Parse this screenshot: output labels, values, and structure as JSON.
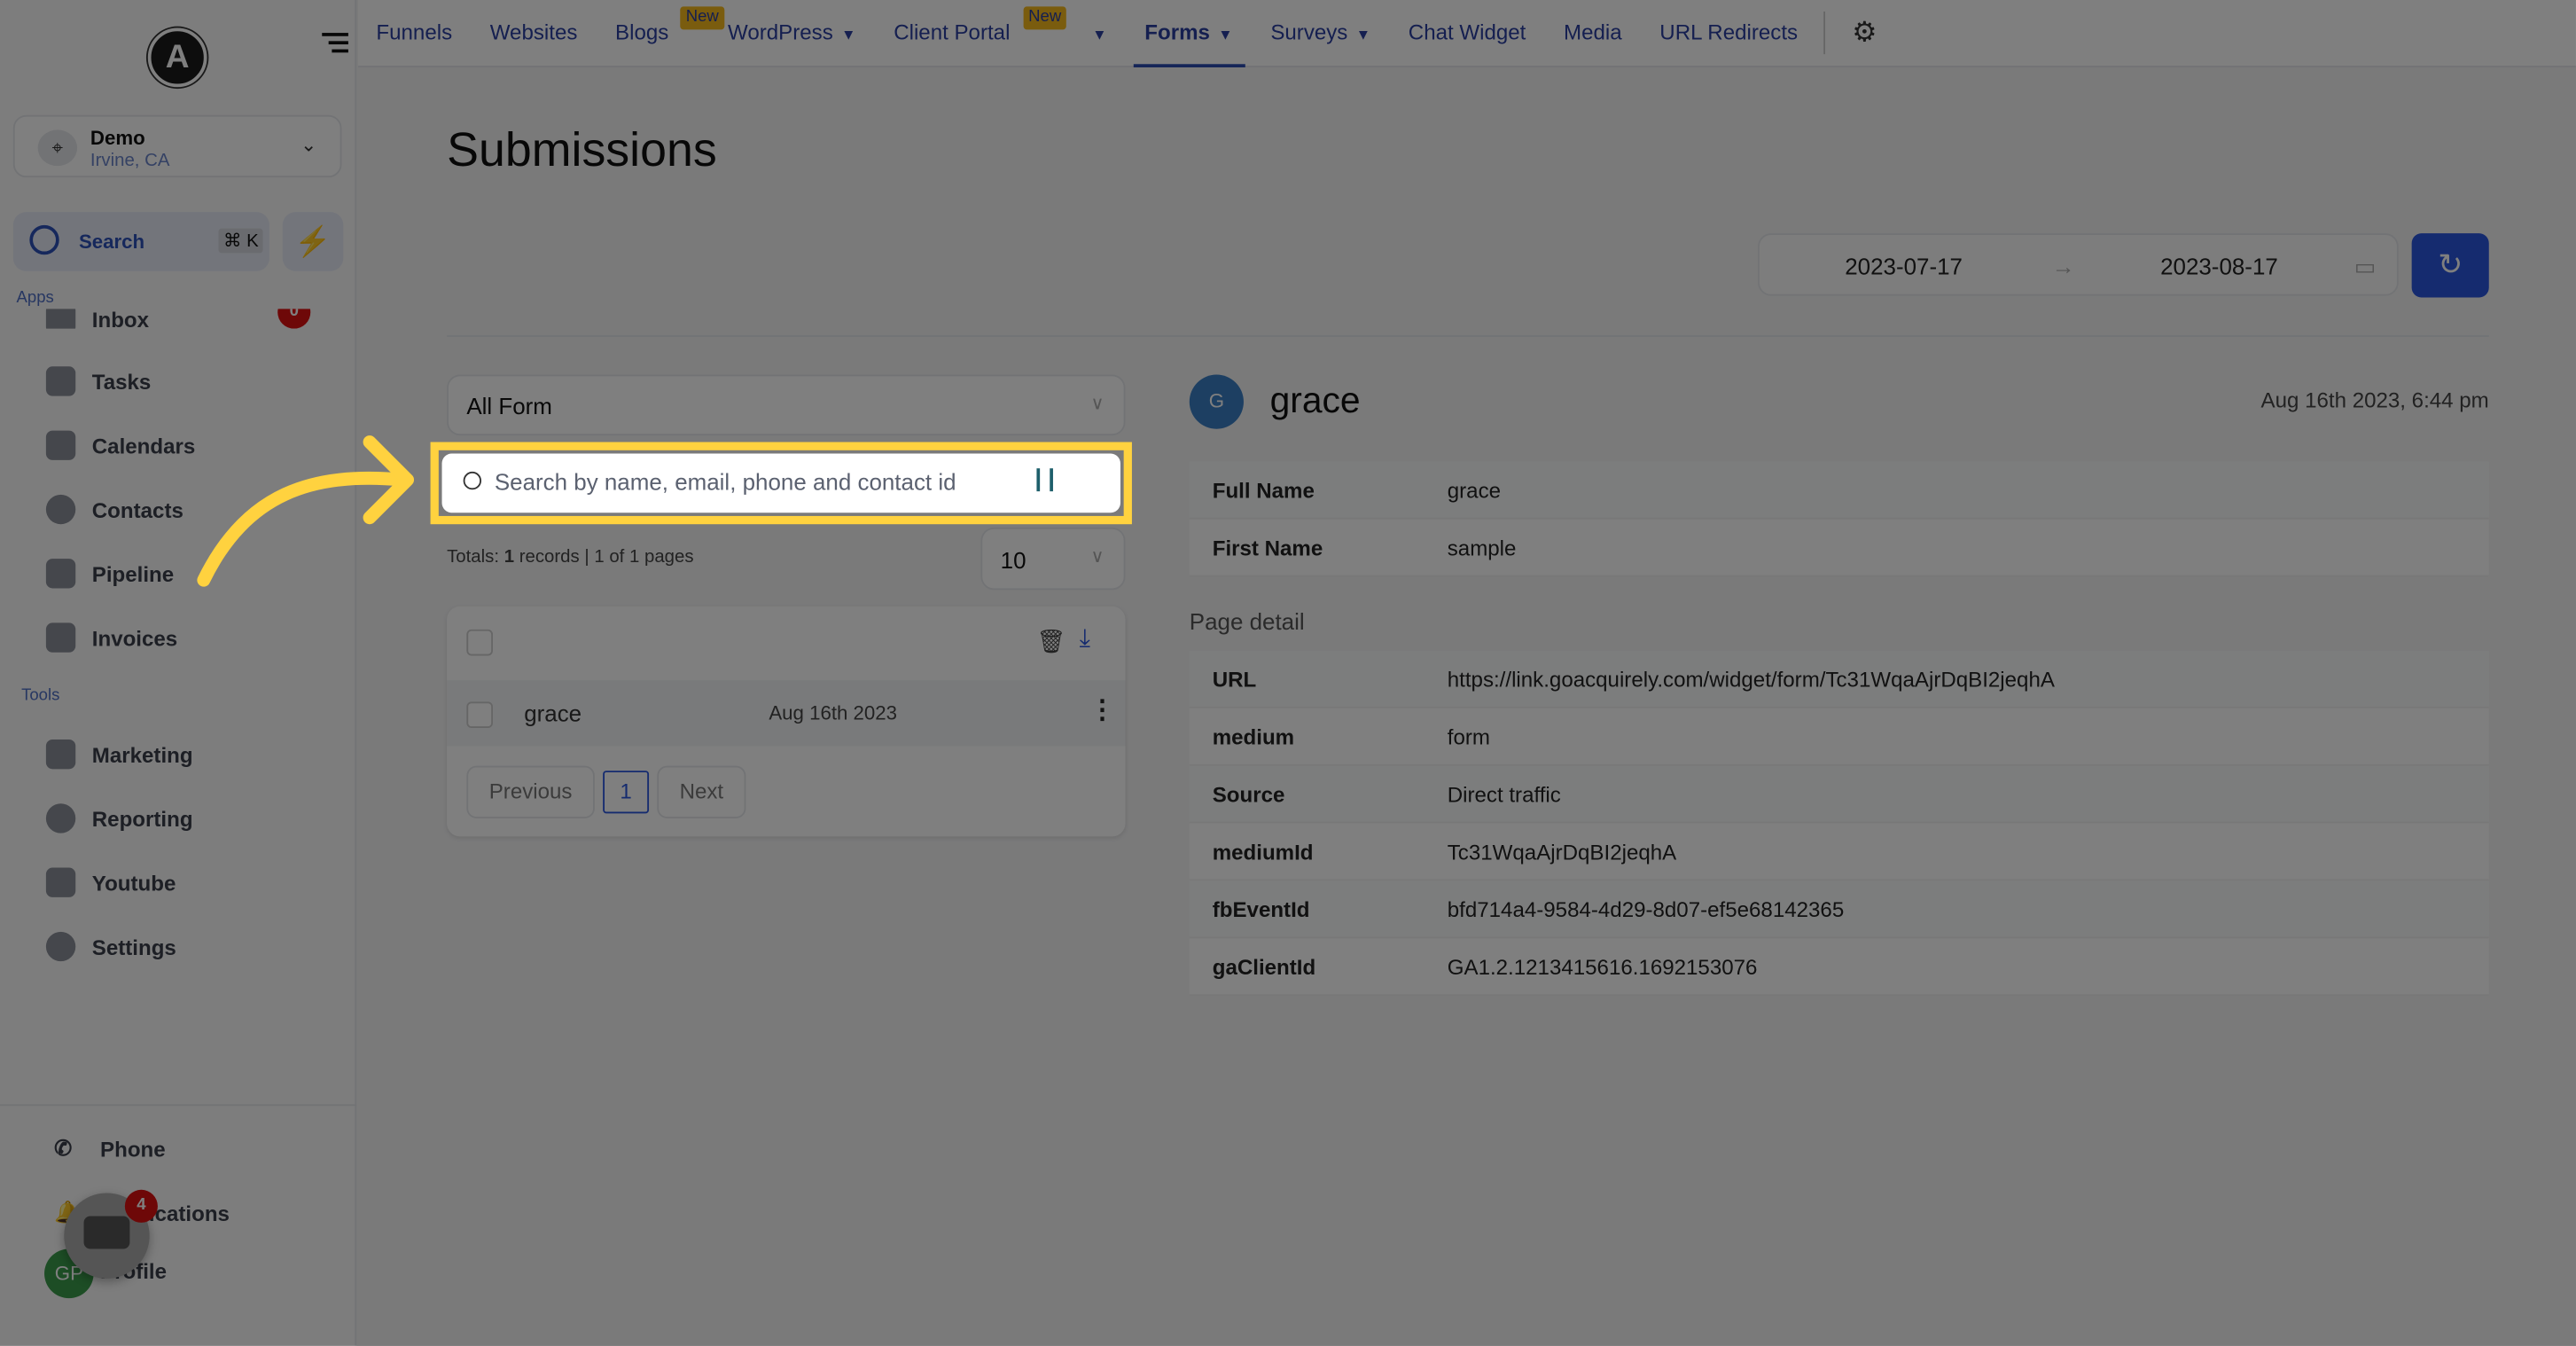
{
  "sidebar": {
    "account": {
      "name": "Demo",
      "location": "Irvine, CA"
    },
    "search_label": "Search",
    "shortcut": "⌘ K",
    "apps_label": "Apps",
    "tools_label": "Tools",
    "apps": [
      {
        "label": "Inbox",
        "badge": "0"
      },
      {
        "label": "Tasks"
      },
      {
        "label": "Calendars"
      },
      {
        "label": "Contacts"
      },
      {
        "label": "Pipeline"
      },
      {
        "label": "Invoices"
      }
    ],
    "tools": [
      {
        "label": "Marketing"
      },
      {
        "label": "Reporting"
      },
      {
        "label": "Youtube"
      },
      {
        "label": "Settings"
      }
    ],
    "bottom": [
      {
        "label": "Phone"
      },
      {
        "label": "Notifications"
      },
      {
        "label": "Profile"
      }
    ],
    "chat_badge": "4",
    "profile_initials": "GP"
  },
  "topnav": {
    "items": [
      {
        "label": "Funnels"
      },
      {
        "label": "Websites"
      },
      {
        "label": "Blogs",
        "badge": "New"
      },
      {
        "label": "WordPress"
      },
      {
        "label": "Client Portal",
        "badge": "New"
      },
      {
        "label": "Forms"
      },
      {
        "label": "Surveys"
      },
      {
        "label": "Chat Widget"
      },
      {
        "label": "Media"
      },
      {
        "label": "URL Redirects"
      }
    ]
  },
  "page": {
    "title": "Submissions",
    "date_from": "2023-07-17",
    "date_to": "2023-08-17"
  },
  "filters": {
    "form_select": "All Form",
    "search_placeholder": "Search by name, email, phone and contact id",
    "page_size": "10"
  },
  "totals": {
    "prefix": "Totals: ",
    "count": "1",
    "suffix": " records | 1 of 1 pages"
  },
  "list": {
    "rows": [
      {
        "name": "grace",
        "date": "Aug 16th 2023"
      }
    ],
    "prev": "Previous",
    "page": "1",
    "next": "Next"
  },
  "detail": {
    "initial": "G",
    "name": "grace",
    "time": "Aug 16th 2023, 6:44 pm",
    "fields": [
      {
        "k": "Full Name",
        "v": "grace"
      },
      {
        "k": "First Name",
        "v": "sample"
      }
    ],
    "page_detail_label": "Page detail",
    "page_fields": [
      {
        "k": "URL",
        "v": "https://link.goacquirely.com/widget/form/Tc31WqaAjrDqBI2jeqhA"
      },
      {
        "k": "medium",
        "v": "form"
      },
      {
        "k": "Source",
        "v": "Direct traffic"
      },
      {
        "k": "mediumId",
        "v": "Tc31WqaAjrDqBI2jeqhA"
      },
      {
        "k": "fbEventId",
        "v": "bfd714a4-9584-4d29-8d07-ef5e68142365"
      },
      {
        "k": "gaClientId",
        "v": "GA1.2.1213415616.1692153076"
      }
    ]
  },
  "colors": {
    "accent": "#2b56de",
    "highlight": "#ffd23f",
    "overlay": "rgba(0,0,0,0.5)"
  }
}
